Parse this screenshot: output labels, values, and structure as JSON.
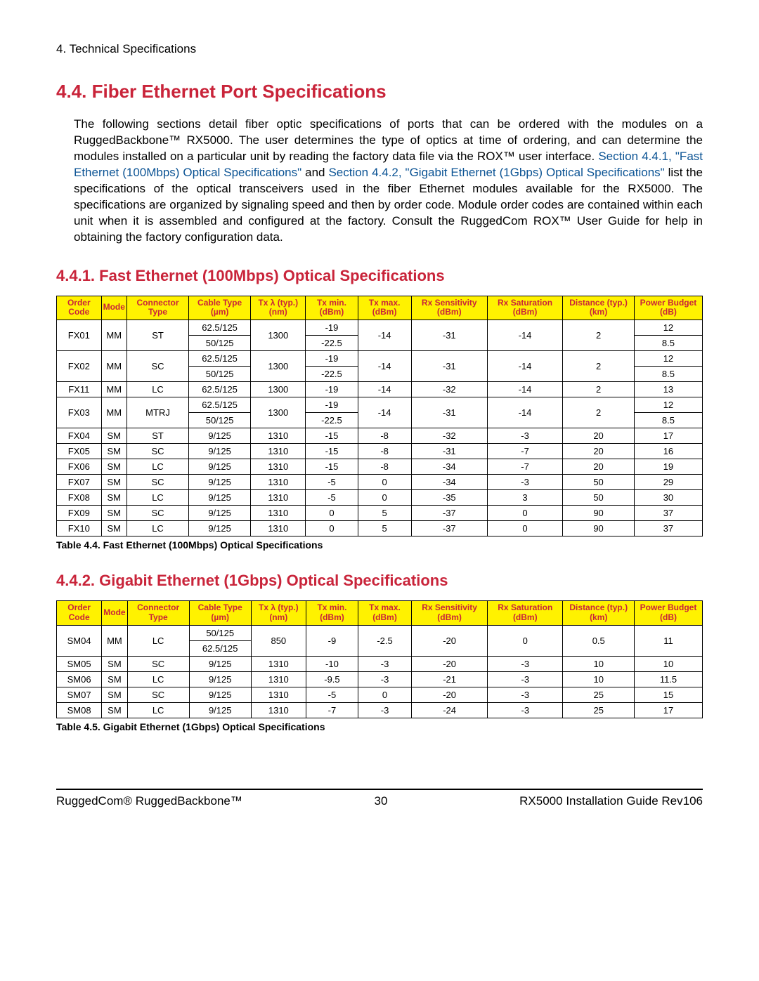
{
  "chapterHeader": "4. Technical Specifications",
  "h1": "4.4. Fiber Ethernet Port Specifications",
  "intro": {
    "p1a": "The following sections detail fiber optic specifications of ports that can be ordered with the modules on a RuggedBackbone™ RX5000. The user determines the type of optics at time of ordering, and can determine the modules installed on a particular unit by reading the factory data file via the ROX™ user interface. ",
    "link1": "Section 4.4.1, \"Fast Ethernet (100Mbps) Optical Specifications\"",
    "p1b": " and ",
    "link2": "Section 4.4.2, \"Gigabit Ethernet (1Gbps) Optical Specifications\"",
    "p1c": " list the specifications of the optical transceivers used in the fiber Ethernet modules available for the RX5000. The specifications are organized by signaling speed and then by order code. Module order codes are contained within each unit when it is assembled and configured at the factory. Consult the RuggedCom ROX™ User Guide for help in obtaining the factory configuration data."
  },
  "h2a": "4.4.1. Fast Ethernet (100Mbps) Optical Specifications",
  "h2b": "4.4.2. Gigabit Ethernet (1Gbps) Optical Specifications",
  "headers": {
    "c0": "Order Code",
    "c1": "Mode",
    "c2": "Connector Type",
    "c3": "Cable Type (µm)",
    "c4": "Tx λ (typ.) (nm)",
    "c5": "Tx min. (dBm)",
    "c6": "Tx max. (dBm)",
    "c7": "Rx Sensitivity (dBm)",
    "c8": "Rx Saturation (dBm)",
    "c9": "Distance (typ.) (km)",
    "c10": "Power Budget (dB)"
  },
  "caption1": "Table 4.4. Fast Ethernet (100Mbps) Optical Specifications",
  "caption2": "Table 4.5. Gigabit Ethernet (1Gbps) Optical Specifications",
  "chart_data": [
    {
      "type": "table",
      "title": "Fast Ethernet (100Mbps) Optical Specifications",
      "rows": [
        {
          "order": "FX01",
          "mode": "MM",
          "conn": "ST",
          "cable": "62.5/125",
          "tx_wl": "1300",
          "tx_min": "-19",
          "tx_max": "-14",
          "rx_sens": "-31",
          "rx_sat": "-14",
          "dist": "2",
          "pb": "12"
        },
        {
          "order": "FX01",
          "mode": "MM",
          "conn": "ST",
          "cable": "50/125",
          "tx_wl": "1300",
          "tx_min": "-22.5",
          "tx_max": "-14",
          "rx_sens": "-31",
          "rx_sat": "-14",
          "dist": "2",
          "pb": "8.5"
        },
        {
          "order": "FX02",
          "mode": "MM",
          "conn": "SC",
          "cable": "62.5/125",
          "tx_wl": "1300",
          "tx_min": "-19",
          "tx_max": "-14",
          "rx_sens": "-31",
          "rx_sat": "-14",
          "dist": "2",
          "pb": "12"
        },
        {
          "order": "FX02",
          "mode": "MM",
          "conn": "SC",
          "cable": "50/125",
          "tx_wl": "1300",
          "tx_min": "-22.5",
          "tx_max": "-14",
          "rx_sens": "-31",
          "rx_sat": "-14",
          "dist": "2",
          "pb": "8.5"
        },
        {
          "order": "FX11",
          "mode": "MM",
          "conn": "LC",
          "cable": "62.5/125",
          "tx_wl": "1300",
          "tx_min": "-19",
          "tx_max": "-14",
          "rx_sens": "-32",
          "rx_sat": "-14",
          "dist": "2",
          "pb": "13"
        },
        {
          "order": "FX03",
          "mode": "MM",
          "conn": "MTRJ",
          "cable": "62.5/125",
          "tx_wl": "1300",
          "tx_min": "-19",
          "tx_max": "-14",
          "rx_sens": "-31",
          "rx_sat": "-14",
          "dist": "2",
          "pb": "12"
        },
        {
          "order": "FX03",
          "mode": "MM",
          "conn": "MTRJ",
          "cable": "50/125",
          "tx_wl": "1300",
          "tx_min": "-22.5",
          "tx_max": "-14",
          "rx_sens": "-31",
          "rx_sat": "-14",
          "dist": "2",
          "pb": "8.5"
        },
        {
          "order": "FX04",
          "mode": "SM",
          "conn": "ST",
          "cable": "9/125",
          "tx_wl": "1310",
          "tx_min": "-15",
          "tx_max": "-8",
          "rx_sens": "-32",
          "rx_sat": "-3",
          "dist": "20",
          "pb": "17"
        },
        {
          "order": "FX05",
          "mode": "SM",
          "conn": "SC",
          "cable": "9/125",
          "tx_wl": "1310",
          "tx_min": "-15",
          "tx_max": "-8",
          "rx_sens": "-31",
          "rx_sat": "-7",
          "dist": "20",
          "pb": "16"
        },
        {
          "order": "FX06",
          "mode": "SM",
          "conn": "LC",
          "cable": "9/125",
          "tx_wl": "1310",
          "tx_min": "-15",
          "tx_max": "-8",
          "rx_sens": "-34",
          "rx_sat": "-7",
          "dist": "20",
          "pb": "19"
        },
        {
          "order": "FX07",
          "mode": "SM",
          "conn": "SC",
          "cable": "9/125",
          "tx_wl": "1310",
          "tx_min": "-5",
          "tx_max": "0",
          "rx_sens": "-34",
          "rx_sat": "-3",
          "dist": "50",
          "pb": "29"
        },
        {
          "order": "FX08",
          "mode": "SM",
          "conn": "LC",
          "cable": "9/125",
          "tx_wl": "1310",
          "tx_min": "-5",
          "tx_max": "0",
          "rx_sens": "-35",
          "rx_sat": "3",
          "dist": "50",
          "pb": "30"
        },
        {
          "order": "FX09",
          "mode": "SM",
          "conn": "SC",
          "cable": "9/125",
          "tx_wl": "1310",
          "tx_min": "0",
          "tx_max": "5",
          "rx_sens": "-37",
          "rx_sat": "0",
          "dist": "90",
          "pb": "37"
        },
        {
          "order": "FX10",
          "mode": "SM",
          "conn": "LC",
          "cable": "9/125",
          "tx_wl": "1310",
          "tx_min": "0",
          "tx_max": "5",
          "rx_sens": "-37",
          "rx_sat": "0",
          "dist": "90",
          "pb": "37"
        }
      ]
    },
    {
      "type": "table",
      "title": "Gigabit Ethernet (1Gbps) Optical Specifications",
      "rows": [
        {
          "order": "SM04",
          "mode": "MM",
          "conn": "LC",
          "cable": "50/125",
          "tx_wl": "850",
          "tx_min": "-9",
          "tx_max": "-2.5",
          "rx_sens": "-20",
          "rx_sat": "0",
          "dist": "0.5",
          "pb": "11"
        },
        {
          "order": "SM04",
          "mode": "MM",
          "conn": "LC",
          "cable": "62.5/125",
          "tx_wl": "850",
          "tx_min": "-9",
          "tx_max": "-2.5",
          "rx_sens": "-20",
          "rx_sat": "0",
          "dist": "0.5",
          "pb": "11"
        },
        {
          "order": "SM05",
          "mode": "SM",
          "conn": "SC",
          "cable": "9/125",
          "tx_wl": "1310",
          "tx_min": "-10",
          "tx_max": "-3",
          "rx_sens": "-20",
          "rx_sat": "-3",
          "dist": "10",
          "pb": "10"
        },
        {
          "order": "SM06",
          "mode": "SM",
          "conn": "LC",
          "cable": "9/125",
          "tx_wl": "1310",
          "tx_min": "-9.5",
          "tx_max": "-3",
          "rx_sens": "-21",
          "rx_sat": "-3",
          "dist": "10",
          "pb": "11.5"
        },
        {
          "order": "SM07",
          "mode": "SM",
          "conn": "SC",
          "cable": "9/125",
          "tx_wl": "1310",
          "tx_min": "-5",
          "tx_max": "0",
          "rx_sens": "-20",
          "rx_sat": "-3",
          "dist": "25",
          "pb": "15"
        },
        {
          "order": "SM08",
          "mode": "SM",
          "conn": "LC",
          "cable": "9/125",
          "tx_wl": "1310",
          "tx_min": "-7",
          "tx_max": "-3",
          "rx_sens": "-24",
          "rx_sat": "-3",
          "dist": "25",
          "pb": "17"
        }
      ]
    }
  ],
  "footer": {
    "left": "RuggedCom® RuggedBackbone™",
    "center": "30",
    "right": "RX5000 Installation Guide Rev106"
  }
}
